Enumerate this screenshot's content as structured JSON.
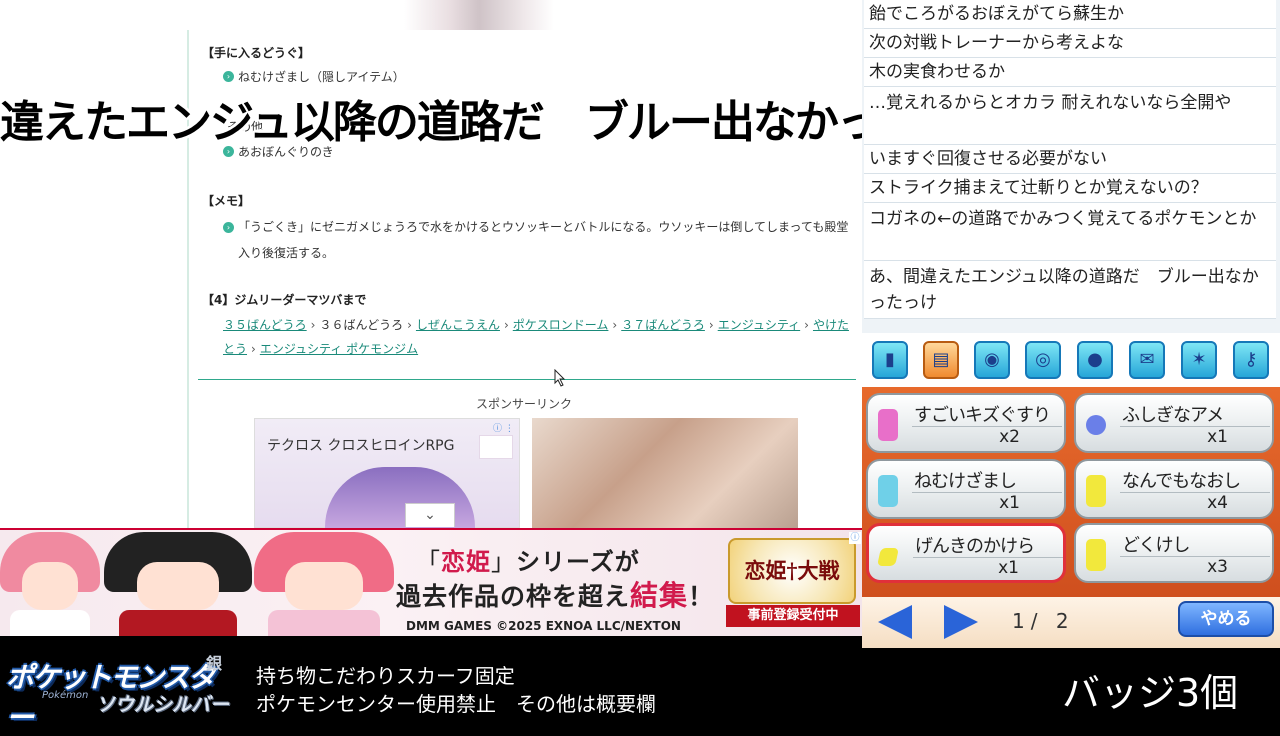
{
  "webpage": {
    "items_heading": "【手に入るどうぐ】",
    "items": [
      "ねむけざまし（隠しアイテム）",
      "その他",
      "あおぼんぐりのき"
    ],
    "memo_heading": "【メモ】",
    "memo_text": "「うごくき」にゼニガメじょうろで水をかけるとウソッキーとバトルになる。ウソッキーは倒してしまっても殿堂入り後復活する。",
    "route_heading": "【4】ジムリーダーマツバまで",
    "route": [
      {
        "text": "３５ばんどうろ",
        "link": true
      },
      {
        "text": "３６ばんどうろ",
        "link": false
      },
      {
        "text": "しぜんこうえん",
        "link": true
      },
      {
        "text": "ポケスロンドーム",
        "link": true
      },
      {
        "text": "３７ばんどうろ",
        "link": true
      },
      {
        "text": "エンジュシティ",
        "link": true
      },
      {
        "text": "やけたとう",
        "link": true
      },
      {
        "text": "エンジュシティ ポケモンジム",
        "link": true
      }
    ],
    "route_separator": "›",
    "sponsor_label": "スポンサーリンク",
    "ad_title": "テクロス クロスヒロインRPG",
    "ad_info": "ⓘ ⋮",
    "expand_chevron": "⌄"
  },
  "banner": {
    "headline_bracket_open": "「",
    "headline_brand": "恋姫",
    "headline_bracket_close": "」",
    "headline_rest": "シリーズが",
    "sub_text": "過去作品の枠を超え",
    "sub_highlight": "結集",
    "sub_end": "！",
    "copyright": "DMM GAMES ©2025 EXNOA LLC/NEXTON",
    "logo_text": "恋姫†大戦",
    "registration": "事前登録受付中"
  },
  "overlay_subtitle": "違えたエンジュ以降の道路だ　ブルー出なかったっけ",
  "chat": {
    "lines": [
      "飴でころがるおぼえがてら蘇生か",
      "次の対戦トレーナーから考えよな",
      "木の実食わせるか",
      "…覚えれるからとオカラ 耐えれないなら全開や",
      "いますぐ回復させる必要がない",
      "ストライク捕まえて辻斬りとか覚えないの？",
      "コガネの←の道路でかみつく覚えてるポケモンとか",
      "あ、間違えたエンジュ以降の道路だ　ブルー出なかったっけ"
    ]
  },
  "bag": {
    "pockets": [
      {
        "icon": "item-pocket-icon",
        "glyph": "▮"
      },
      {
        "icon": "medicine-pocket-icon",
        "glyph": "▤"
      },
      {
        "icon": "pokeball-pocket-icon",
        "glyph": "◉"
      },
      {
        "icon": "tm-pocket-icon",
        "glyph": "◎"
      },
      {
        "icon": "berry-pocket-icon",
        "glyph": "●"
      },
      {
        "icon": "mail-pocket-icon",
        "glyph": "✉"
      },
      {
        "icon": "battle-item-pocket-icon",
        "glyph": "✶"
      },
      {
        "icon": "key-item-pocket-icon",
        "glyph": "⚷"
      }
    ],
    "items": [
      {
        "name": "すごいキズぐすり",
        "qty": "x2",
        "color": "#e86fc9"
      },
      {
        "name": "ふしぎなアメ",
        "qty": "x1",
        "color": "#6a7fe8"
      },
      {
        "name": "ねむけざまし",
        "qty": "x1",
        "color": "#6fd0e8"
      },
      {
        "name": "なんでもなおし",
        "qty": "x4",
        "color": "#f2e83c"
      },
      {
        "name": "げんきのかけら",
        "qty": "x1",
        "color": "#f2e83c"
      },
      {
        "name": "どくけし",
        "qty": "x3",
        "color": "#f2e83c"
      }
    ],
    "selected_index": 4,
    "page": "1/ 2",
    "quit_label": "やめる",
    "colors": {
      "accent": "#2a64d8",
      "selected_border": "#e0303a",
      "background": "#e76a2c"
    }
  },
  "infobar": {
    "logo_main": "ポケットモンスター",
    "logo_sub": "ソウルシルバー",
    "logo_edition": "銀",
    "logo_small": "Pokémon",
    "rule_line1": "持ち物こだわりスカーフ固定",
    "rule_line2": "ポケモンセンター使用禁止　その他は概要欄",
    "badges": "バッジ3個"
  }
}
